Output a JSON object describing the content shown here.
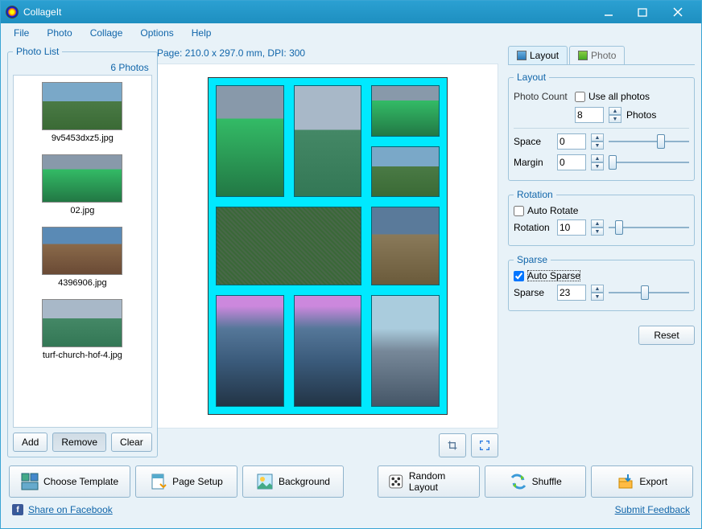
{
  "window": {
    "title": "CollageIt"
  },
  "menu": {
    "file": "File",
    "photo": "Photo",
    "collage": "Collage",
    "options": "Options",
    "help": "Help"
  },
  "photolist": {
    "title": "Photo List",
    "count": "6 Photos",
    "items": [
      {
        "name": "9v5453dxz5.jpg"
      },
      {
        "name": "02.jpg"
      },
      {
        "name": "4396906.jpg"
      },
      {
        "name": "turf-church-hof-4.jpg"
      }
    ],
    "add": "Add",
    "remove": "Remove",
    "clear": "Clear"
  },
  "page": {
    "info": "Page: 210.0 x 297.0 mm, DPI: 300"
  },
  "tabs": {
    "layout": "Layout",
    "photo": "Photo"
  },
  "layout": {
    "group": "Layout",
    "photo_count": "Photo Count",
    "use_all": "Use all photos",
    "count_value": "8",
    "photos_suffix": "Photos",
    "space": "Space",
    "space_value": "0",
    "margin": "Margin",
    "margin_value": "0"
  },
  "rotation": {
    "group": "Rotation",
    "auto": "Auto Rotate",
    "label": "Rotation",
    "value": "10"
  },
  "sparse": {
    "group": "Sparse",
    "auto": "Auto Sparse",
    "label": "Sparse",
    "value": "23"
  },
  "reset": "Reset",
  "bottom": {
    "choose": "Choose Template",
    "page": "Page Setup",
    "bg": "Background",
    "random": "Random Layout",
    "shuffle": "Shuffle",
    "export": "Export"
  },
  "footer": {
    "fb": "Share on Facebook",
    "feedback": "Submit Feedback"
  }
}
